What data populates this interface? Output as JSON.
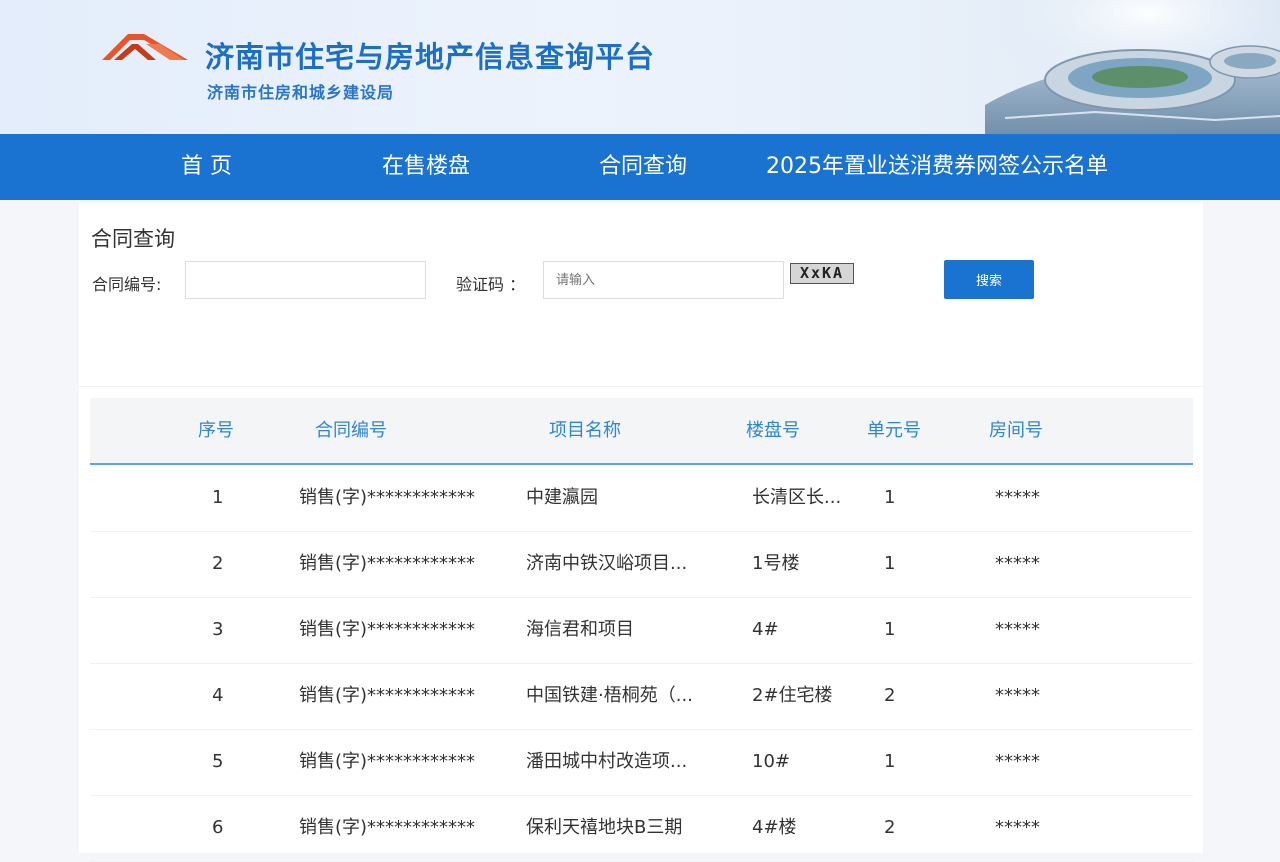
{
  "header": {
    "title": "济南市住宅与房地产信息查询平台",
    "subtitle": "济南市住房和城乡建设局"
  },
  "nav": {
    "items": [
      {
        "label": "首  页"
      },
      {
        "label": "在售楼盘"
      },
      {
        "label": "合同查询"
      },
      {
        "label": "2025年置业送消费券网签公示名单"
      }
    ]
  },
  "search": {
    "title": "合同查询",
    "contract_label": "合同编号:",
    "contract_value": "",
    "captcha_label": "验证码 ：",
    "captcha_placeholder": "请输入",
    "captcha_code": "XxKA",
    "search_label": "搜索"
  },
  "table": {
    "headers": [
      "序号",
      "合同编号",
      "项目名称",
      "楼盘号",
      "单元号",
      "房间号"
    ],
    "rows": [
      [
        "1",
        "销售(字)************",
        "中建瀛园",
        "长清区长...",
        "1",
        "*****"
      ],
      [
        "2",
        "销售(字)************",
        "济南中铁汉峪项目...",
        "1号楼",
        "1",
        "*****"
      ],
      [
        "3",
        "销售(字)************",
        "海信君和项目",
        "4#",
        "1",
        "*****"
      ],
      [
        "4",
        "销售(字)************",
        "中国铁建·梧桐苑（...",
        "2#住宅楼",
        "2",
        "*****"
      ],
      [
        "5",
        "销售(字)************",
        "潘田城中村改造项...",
        "10#",
        "1",
        "*****"
      ],
      [
        "6",
        "销售(字)************",
        "保利天禧地块B三期",
        "4#楼",
        "2",
        "*****"
      ]
    ]
  },
  "colors": {
    "brand_blue": "#1a73d0",
    "title_blue": "#1d6fc6",
    "logo_red": "#e8542a",
    "header_text": "#2f85d6"
  }
}
